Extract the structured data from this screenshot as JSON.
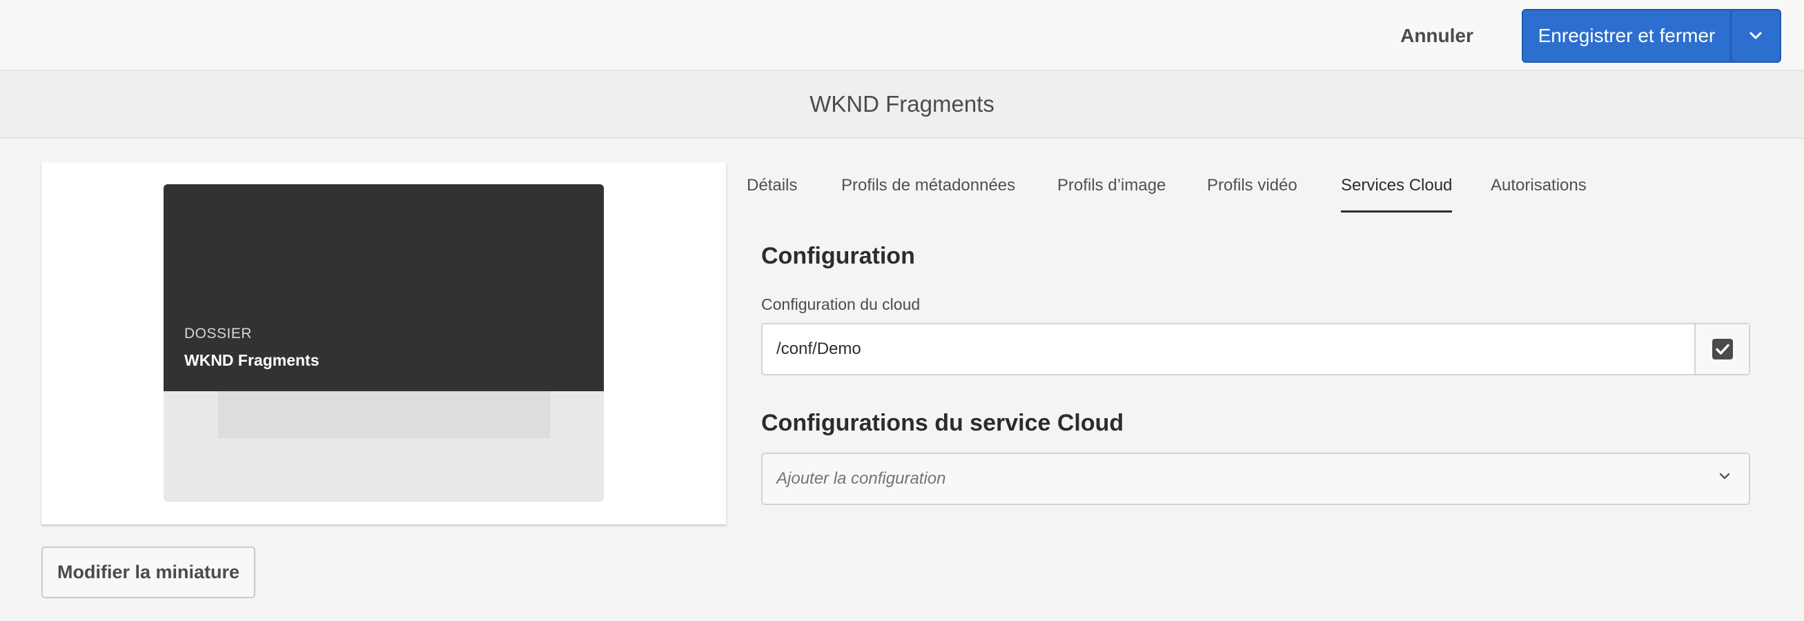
{
  "toolbar": {
    "cancel_label": "Annuler",
    "save_label": "Enregistrer et fermer",
    "caret_icon": "chevron-down-icon"
  },
  "page": {
    "title": "WKND Fragments"
  },
  "thumbnail": {
    "type_label": "DOSSIER",
    "name": "WKND Fragments",
    "modify_label": "Modifier la miniature"
  },
  "tabs": [
    {
      "label": "Détails",
      "active": false
    },
    {
      "label": "Profils de métadonnées",
      "active": false
    },
    {
      "label": "Profils d’image",
      "active": false
    },
    {
      "label": "Profils vidéo",
      "active": false
    },
    {
      "label": "Services Cloud",
      "active": true
    },
    {
      "label": "Autorisations",
      "active": false
    }
  ],
  "configuration": {
    "heading": "Configuration",
    "field_label": "Configuration du cloud",
    "value": "/conf/Demo",
    "picker_icon": "checkbox-checked-icon"
  },
  "cloud_services": {
    "heading": "Configurations du service Cloud",
    "placeholder": "Ajouter la configuration",
    "caret_icon": "chevron-down-icon"
  },
  "colors": {
    "primary": "#2d6fcf",
    "background": "#f4f4f4",
    "folder_dark": "#323232"
  }
}
